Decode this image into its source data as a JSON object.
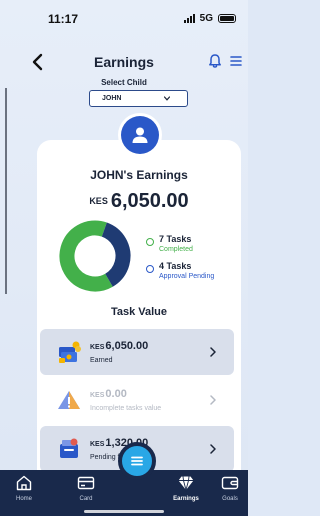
{
  "status_bar": {
    "time": "11:17",
    "network": "5G"
  },
  "header": {
    "title": "Earnings",
    "select_child_label": "Select Child",
    "selected_child": "JOHN"
  },
  "summary": {
    "heading": "JOHN's Earnings",
    "currency": "KES",
    "total": "6,050.00"
  },
  "chart_data": {
    "type": "pie",
    "categories": [
      "Tasks Completed",
      "Tasks Approval Pending"
    ],
    "values": [
      7,
      4
    ],
    "colors": [
      "#43b04a",
      "#1f3b73"
    ]
  },
  "legend": [
    {
      "count": "7 Tasks",
      "label": "Completed",
      "color": "#43b04a"
    },
    {
      "count": "4 Tasks",
      "label": "Approval Pending",
      "color": "#2a58c8"
    }
  ],
  "task_value": {
    "title": "Task Value",
    "rows": [
      {
        "currency": "KES",
        "amount": "6,050.00",
        "description": "Earned",
        "background": "#d9dfeb",
        "text_color": "#1b2437",
        "icon": "money-stack-icon"
      },
      {
        "currency": "KES",
        "amount": "0.00",
        "description": "Incomplete tasks value",
        "background": "#ffffff",
        "text_color": "#b4b9c3",
        "icon": "warning-icon"
      },
      {
        "currency": "KES",
        "amount": "1,320.00",
        "description": "Pending for approval",
        "background": "#d9dfeb",
        "text_color": "#1b2437",
        "icon": "pending-wallet-icon"
      }
    ]
  },
  "nav": {
    "items": [
      {
        "label": "Home",
        "icon": "home-icon"
      },
      {
        "label": "Card",
        "icon": "card-icon"
      },
      {
        "label": "Earnings",
        "icon": "diamond-icon",
        "active": true
      },
      {
        "label": "Goals",
        "icon": "wallet-icon"
      }
    ],
    "fab_icon": "list-icon"
  }
}
